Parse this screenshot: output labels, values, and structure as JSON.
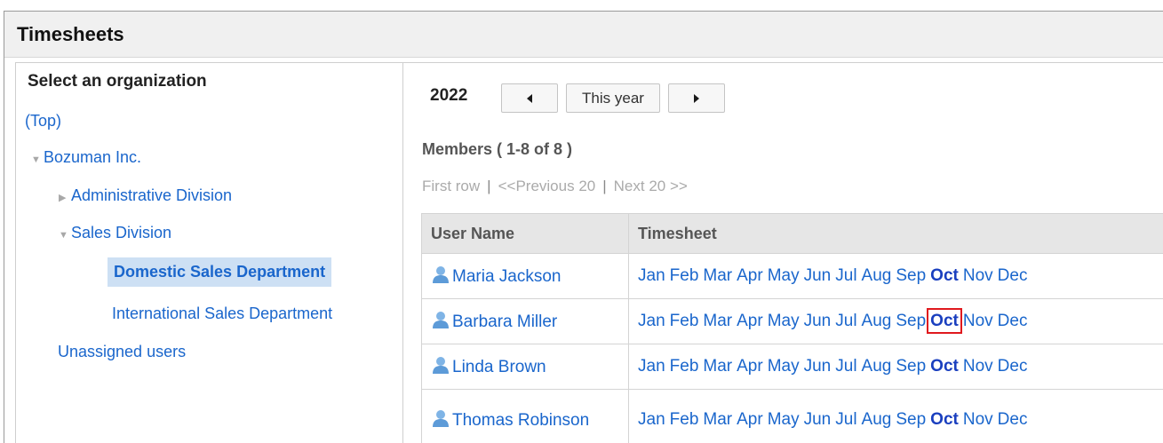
{
  "header": {
    "title": "Timesheets"
  },
  "org_tree": {
    "heading": "Select an organization",
    "top_link": "(Top)",
    "items": [
      {
        "label": "Bozuman Inc.",
        "arrow": "▼"
      },
      {
        "label": "Administrative Division",
        "arrow": "▶"
      },
      {
        "label": "Sales Division",
        "arrow": "▼"
      },
      {
        "label": "Domestic Sales Department"
      },
      {
        "label": "International Sales Department"
      },
      {
        "label": "Unassigned users"
      }
    ],
    "selected": "Domestic Sales Department"
  },
  "year_nav": {
    "year": "2022",
    "prev_icon": "triangle-left-icon",
    "this_year_label": "This year",
    "next_icon": "triangle-right-icon"
  },
  "members": {
    "heading": "Members ( 1-8 of 8 )",
    "pager": {
      "first": "First row",
      "separator": "|",
      "prev": "<<Previous 20",
      "next": "Next 20 >>"
    }
  },
  "table": {
    "headers": {
      "user": "User Name",
      "timesheet": "Timesheet"
    },
    "months": [
      "Jan",
      "Feb",
      "Mar",
      "Apr",
      "May",
      "Jun",
      "Jul",
      "Aug",
      "Sep",
      "Oct",
      "Nov",
      "Dec"
    ],
    "current_month": "Oct",
    "rows": [
      {
        "user": "Maria Jackson",
        "icon": "user-icon"
      },
      {
        "user": "Barbara Miller",
        "icon": "user-icon",
        "highlighted_month": "Oct"
      },
      {
        "user": "Linda Brown",
        "icon": "user-icon"
      },
      {
        "user": "Thomas Robinson",
        "icon": "user-icon"
      }
    ]
  },
  "colors": {
    "link": "#1a66cc",
    "selected_bg": "#cde0f4",
    "highlight_box": "#e0191e"
  }
}
